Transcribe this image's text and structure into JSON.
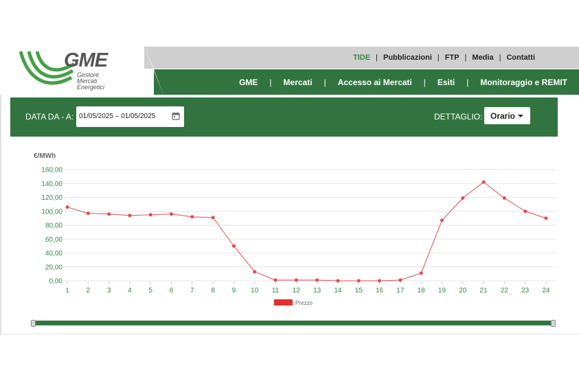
{
  "header": {
    "logo": {
      "name": "GME",
      "sub": [
        "Gestore",
        "Mercati",
        "Energetici"
      ]
    },
    "top_nav": [
      {
        "label": "TIDE",
        "active": true
      },
      {
        "label": "Pubblicazioni",
        "active": false
      },
      {
        "label": "FTP",
        "active": false
      },
      {
        "label": "Media",
        "active": false
      },
      {
        "label": "Contatti",
        "active": false
      }
    ],
    "main_nav": [
      {
        "label": "GME"
      },
      {
        "label": "Mercati"
      },
      {
        "label": "Accesso ai Mercati"
      },
      {
        "label": "Esiti"
      },
      {
        "label": "Monitoraggio e REMIT"
      }
    ]
  },
  "filter": {
    "date_label": "DATA DA - A:",
    "date_value": "01/05/2025 – 01/05/2025",
    "detail_label": "DETTAGLIO:",
    "detail_value": "Orario"
  },
  "colors": {
    "brand_green": "#327440",
    "active_link": "#2f8a43",
    "series": "#e8474f",
    "legend_swatch": "#e3312d",
    "axis_text": "#2f8a43"
  },
  "chart_data": {
    "type": "line",
    "ylabel": "€/MWh",
    "ylim": [
      0,
      160
    ],
    "yticks": [
      "0,00",
      "20,00",
      "40,00",
      "60,00",
      "80,00",
      "100,00",
      "120,00",
      "140,00",
      "160,00"
    ],
    "ytick_values": [
      0,
      20,
      40,
      60,
      80,
      100,
      120,
      140,
      160
    ],
    "categories": [
      "1",
      "2",
      "3",
      "4",
      "5",
      "6",
      "7",
      "8",
      "9",
      "10",
      "11",
      "12",
      "13",
      "14",
      "15",
      "16",
      "17",
      "18",
      "19",
      "20",
      "21",
      "22",
      "23",
      "24"
    ],
    "grid": true,
    "legend_position": "bottom",
    "series": [
      {
        "name": "Prezzo",
        "values": [
          106,
          97,
          96,
          94,
          95,
          96,
          92,
          91,
          50,
          13,
          1,
          1,
          1,
          0,
          0,
          0,
          1,
          11,
          87,
          119,
          142,
          119,
          100,
          90
        ]
      }
    ]
  },
  "slider": {
    "range": [
      1,
      24
    ]
  }
}
